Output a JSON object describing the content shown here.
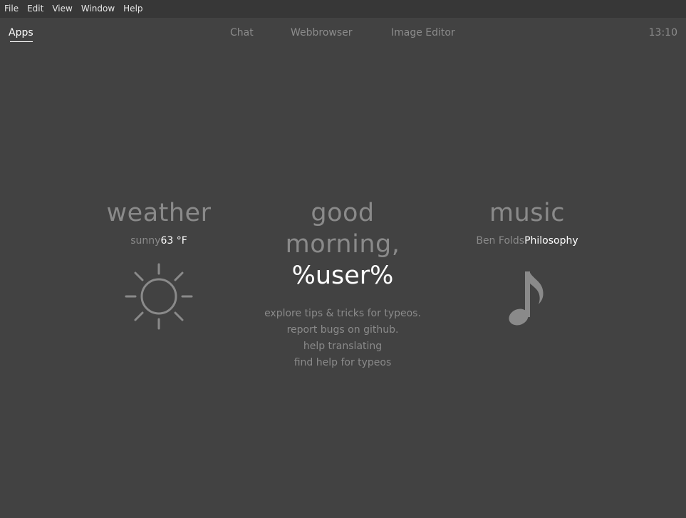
{
  "menubar": {
    "items": [
      "File",
      "Edit",
      "View",
      "Window",
      "Help"
    ]
  },
  "topbar": {
    "tabs": [
      "Apps",
      "Chat",
      "Webbrowser",
      "Image Editor"
    ],
    "active_tab": "Apps",
    "clock": "13:10"
  },
  "weather": {
    "title": "weather",
    "condition": "sunny",
    "temperature": "63 °F",
    "icon": "sun-icon"
  },
  "greeting": {
    "line1": "good",
    "line2": "morning,",
    "user": "%user%",
    "links": [
      "explore tips & tricks for typeos.",
      "report bugs on github.",
      "help translating",
      "find help for typeos"
    ]
  },
  "music": {
    "title": "music",
    "artist": "Ben Folds",
    "track": "Philosophy",
    "icon": "music-note-icon"
  },
  "colors": {
    "background": "#424242",
    "menubar": "#373737",
    "dim_text": "#8a8a8a",
    "bright_text": "#ffffff"
  }
}
